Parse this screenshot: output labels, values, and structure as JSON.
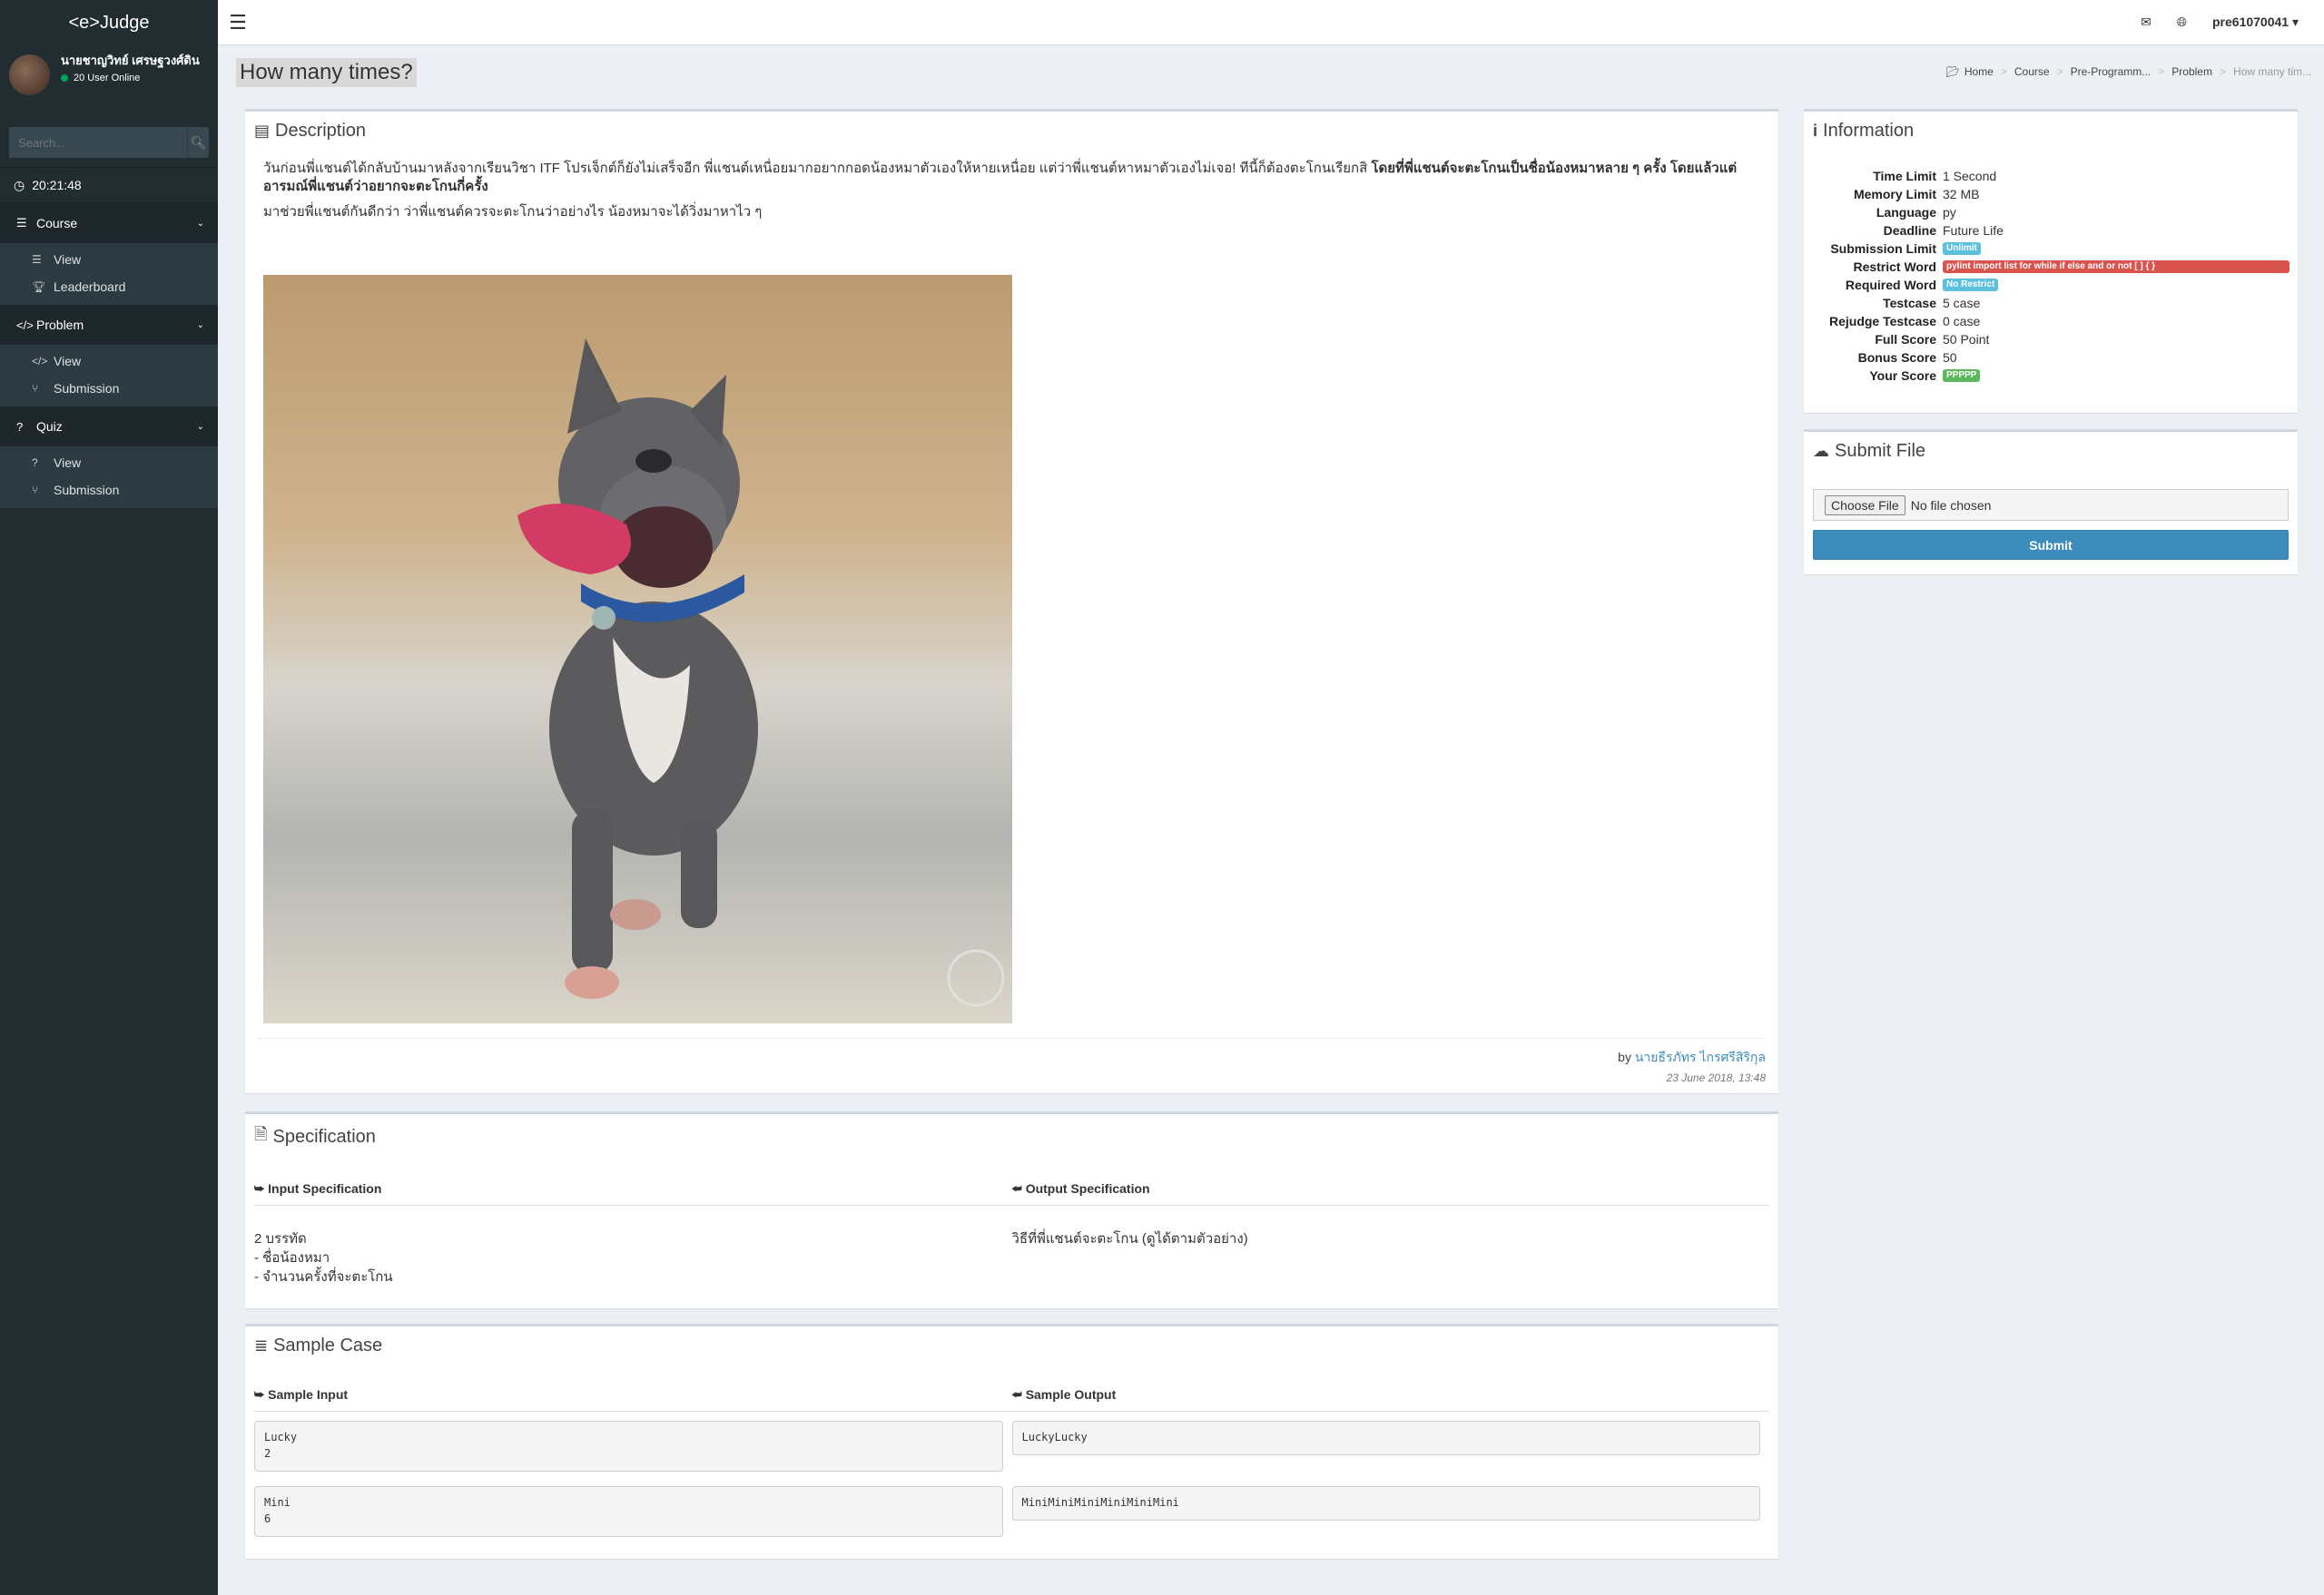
{
  "app": {
    "logo": "<e>Judge"
  },
  "user_panel": {
    "name": "นายชาญวิทย์ เศรษฐวงศ์ดิน",
    "online": "20 User Online"
  },
  "sidebar": {
    "search_placeholder": "Search...",
    "clock": "20:21:48",
    "groups": [
      {
        "label": "Course",
        "items": [
          {
            "label": "View"
          },
          {
            "label": "Leaderboard"
          }
        ]
      },
      {
        "label": "Problem",
        "items": [
          {
            "label": "View"
          },
          {
            "label": "Submission"
          }
        ]
      },
      {
        "label": "Quiz",
        "items": [
          {
            "label": "View"
          },
          {
            "label": "Submission"
          }
        ]
      }
    ]
  },
  "topbar": {
    "username": "pre61070041"
  },
  "page": {
    "title": "How many times?"
  },
  "breadcrumb": [
    "Home",
    "Course",
    "Pre-Programm...",
    "Problem",
    "How many tim..."
  ],
  "description": {
    "title": "Description",
    "para1": "วันก่อนพี่แชนต์ได้กลับบ้านมาหลังจากเรียนวิชา ITF โปรเจ็กต์ก็ยังไม่เสร็จอีก พี่แชนต์เหนื่อยมากอยากกอดน้องหมาตัวเองให้หายเหนื่อย แต่ว่าพี่แชนต์หาหมาตัวเองไม่เจอ! ทีนี้ก็ต้องตะโกนเรียกสิ",
    "para1_bold": "โดยที่พี่แชนต์จะตะโกนเป็นชื่อน้องหมาหลาย ๆ ครั้ง โดยแล้วแต่อารมณ์พี่แชนต์ว่าอยากจะตะโกนกี่ครั้ง",
    "para2": "มาช่วยพี่แชนต์กันดีกว่า ว่าพี่แชนต์ควรจะตะโกนว่าอย่างไร น้องหมาจะได้วิ่งมาหาไว ๆ",
    "by_label": "by",
    "author": "นายธีรภัทร ไกรศรีสิริกุล",
    "date": "23 June 2018, 13:48"
  },
  "specification": {
    "title": "Specification",
    "input_head": "Input Specification",
    "output_head": "Output Specification",
    "input_lines": [
      "2 บรรทัด",
      "- ชื่อน้องหมา",
      "- จำนวนครั้งที่จะตะโกน"
    ],
    "output_text": "วิธีที่พี่แชนต์จะตะโกน (ดูได้ตามตัวอย่าง)"
  },
  "sample": {
    "title": "Sample Case",
    "input_head": "Sample Input",
    "output_head": "Sample Output",
    "cases": [
      {
        "input": "Lucky\n2",
        "output": "LuckyLucky"
      },
      {
        "input": "Mini\n6",
        "output": "MiniMiniMiniMiniMiniMini"
      }
    ]
  },
  "information": {
    "title": "Information",
    "rows": [
      {
        "key": "Time Limit",
        "value": "1 Second"
      },
      {
        "key": "Memory Limit",
        "value": "32 MB"
      },
      {
        "key": "Language",
        "value": "py"
      },
      {
        "key": "Deadline",
        "value": "Future Life"
      },
      {
        "key": "Submission Limit",
        "value": "Unlimit"
      },
      {
        "key": "Restrict Word",
        "value": "pylint import list for while if else and or not [ ] { }"
      },
      {
        "key": "Required Word",
        "value": "No Restrict"
      },
      {
        "key": "Testcase",
        "value": "5 case"
      },
      {
        "key": "Rejudge Testcase",
        "value": "0 case"
      },
      {
        "key": "Full Score",
        "value": "50 Point"
      },
      {
        "key": "Bonus Score",
        "value": "50"
      },
      {
        "key": "Your Score",
        "value": "PPPPP"
      }
    ]
  },
  "submit": {
    "title": "Submit File",
    "choose_label": "Choose File",
    "file_status": "No file chosen",
    "button": "Submit"
  },
  "colors": {
    "primary": "#3c8dbc",
    "sidebar": "#222d32",
    "info_label": "#5bc0de",
    "danger": "#d9534f",
    "success": "#5cb85c"
  }
}
